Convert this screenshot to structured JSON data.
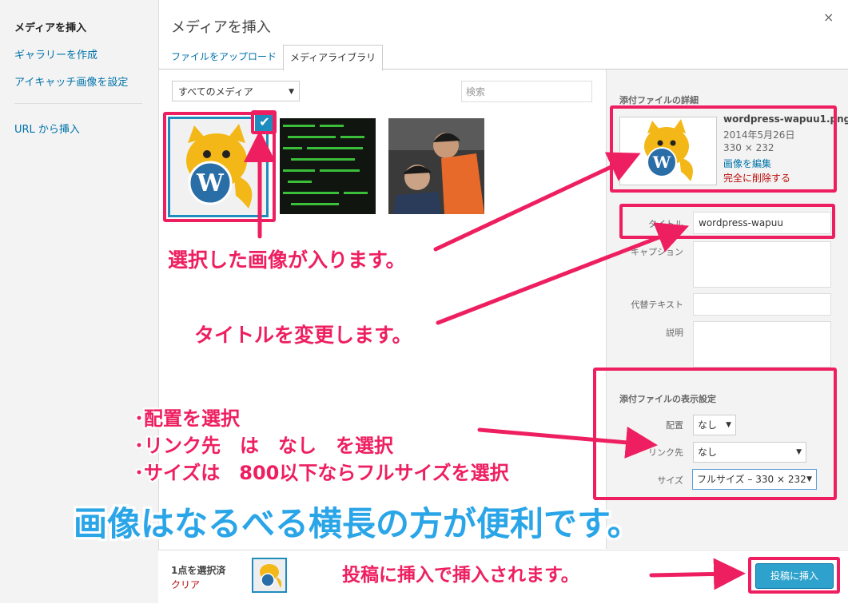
{
  "menu": {
    "items": [
      {
        "label": "メディアを挿入",
        "active": true
      },
      {
        "label": "ギャラリーを作成",
        "active": false
      },
      {
        "label": "アイキャッチ画像を設定",
        "active": false
      },
      {
        "label": "URL から挿入",
        "active": false
      }
    ]
  },
  "modal": {
    "title": "メディアを挿入",
    "close_icon": "×",
    "tabs": [
      "ファイルをアップロード",
      "メディアライブラリ"
    ]
  },
  "toolbar": {
    "filter_value": "すべてのメディア",
    "search_placeholder": "検索"
  },
  "library": {
    "check_icon": "✔"
  },
  "details": {
    "heading": "添付ファイルの詳細",
    "filename": "wordpress-wapuu1.png",
    "date": "2014年5月26日",
    "dimensions": "330 × 232",
    "edit_link": "画像を編集",
    "delete_link": "完全に削除する",
    "fields": {
      "title_label": "タイトル",
      "title_value": "wordpress-wapuu",
      "caption_label": "キャプション",
      "alt_label": "代替テキスト",
      "description_label": "説明"
    }
  },
  "display": {
    "heading": "添付ファイルの表示設定",
    "align_label": "配置",
    "align_value": "なし",
    "link_label": "リンク先",
    "link_value": "なし",
    "size_label": "サイズ",
    "size_value": "フルサイズ – 330 × 232"
  },
  "footer": {
    "selected_count": "1点を選択済",
    "clear_link": "クリア",
    "insert_button": "投稿に挿入"
  },
  "annotations": {
    "image_note": "選択した画像が入ります。",
    "title_note": "タイトルを変更します。",
    "settings_note_1": "･配置を選択",
    "settings_note_2": "･リンク先　は　なし　を選択",
    "settings_note_3": "･サイズは　800以下ならフルサイズを選択",
    "big_caption": "画像はなるべる横長の方が便利です。",
    "insert_note": "投稿に挿入で挿入されます。"
  },
  "colors": {
    "annotation": "#ee1f60",
    "caption_blue": "#29a5e8",
    "wp_blue": "#1e8cbe"
  }
}
